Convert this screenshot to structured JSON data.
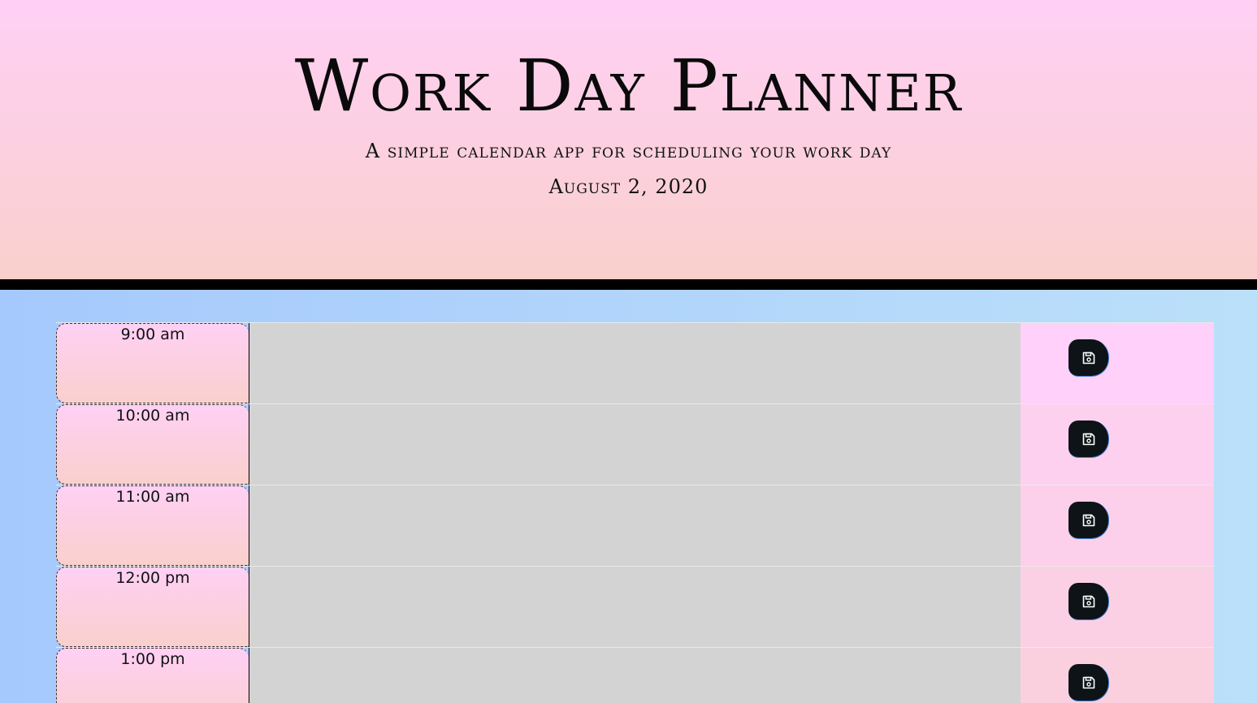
{
  "header": {
    "title": "Work Day Planner",
    "subtitle": "A simple calendar app for scheduling your work day",
    "date": "August 2, 2020"
  },
  "colors": {
    "header_gradient_top": "#ffd0f5",
    "header_gradient_bottom": "#f9d0cc",
    "divider": "#000000",
    "background_gradient_left": "#a6c9fd",
    "background_gradient_right": "#bbe0f9",
    "textarea_past": "#d3d3d3",
    "save_button": "#0d1316"
  },
  "save_icon": "floppy-disk-icon",
  "rows": [
    {
      "hour": "9:00 am",
      "text": "",
      "save_bg": "#ffd0f9"
    },
    {
      "hour": "10:00 am",
      "text": "",
      "save_bg": "#fdd0f0"
    },
    {
      "hour": "11:00 am",
      "text": "",
      "save_bg": "#fcd0ea"
    },
    {
      "hour": "12:00 pm",
      "text": "",
      "save_bg": "#fbd0e4"
    },
    {
      "hour": "1:00 pm",
      "text": "",
      "save_bg": "#fad0df"
    }
  ]
}
